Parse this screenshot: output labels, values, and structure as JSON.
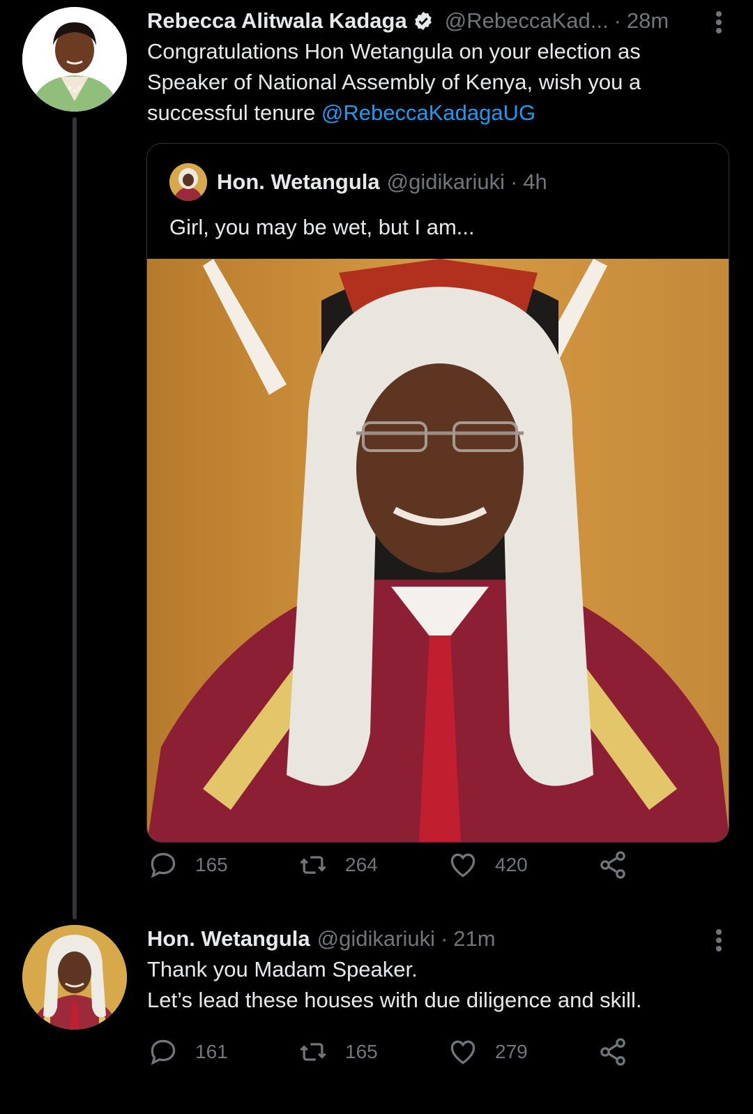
{
  "tweet1": {
    "name": "Rebecca Alitwala Kadaga",
    "handle": "@RebeccaKad...",
    "sep": "·",
    "time": "28m",
    "text": "Congratulations  Hon Wetangula  on your election  as Speaker of National  Assembly of Kenya,  wish you a successful  tenure ",
    "mention": "@RebeccaKadagaUG",
    "replies": "165",
    "retweets": "264",
    "likes": "420"
  },
  "quote": {
    "name": "Hon. Wetangula",
    "handle": "@gidikariuki",
    "sep": "·",
    "time": "4h",
    "text": "Girl, you may be wet, but I am..."
  },
  "tweet2": {
    "name": "Hon. Wetangula",
    "handle": "@gidikariuki",
    "sep": "·",
    "time": "21m",
    "line1": "Thank you Madam Speaker.",
    "line2": "Let’s lead these houses with due diligence and skill.",
    "replies": "161",
    "retweets": "165",
    "likes": "279"
  },
  "icons": {
    "reply": "reply-icon",
    "retweet": "retweet-icon",
    "like": "heart-icon",
    "share": "share-icon",
    "verified": "verified-badge-icon",
    "more": "more-options-icon"
  },
  "colors": {
    "background": "#000000",
    "text": "#e7e9ea",
    "muted": "#71767b",
    "link": "#1d9bf0",
    "border": "#2f3336"
  }
}
